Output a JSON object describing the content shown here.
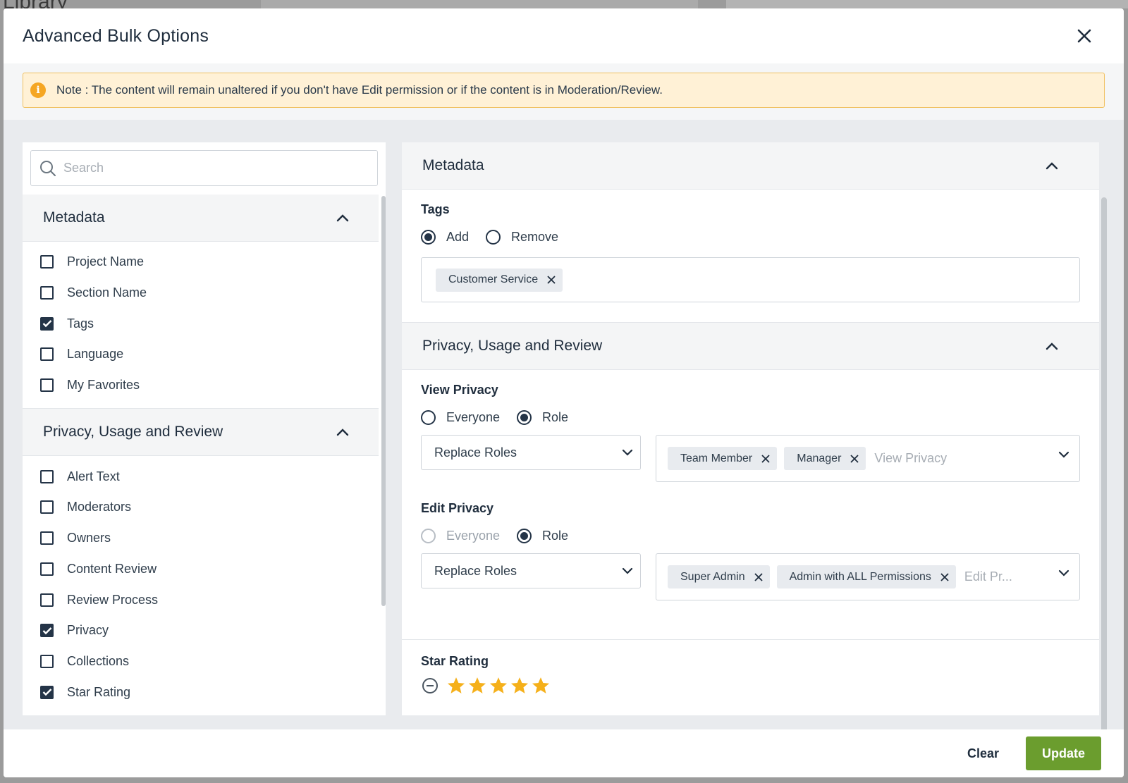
{
  "background": {
    "title": "Library"
  },
  "modal": {
    "title": "Advanced Bulk Options",
    "note": "Note : The content will remain unaltered if you don't have Edit permission or if the content is in Moderation/Review."
  },
  "left": {
    "search_placeholder": "Search",
    "sections": [
      {
        "title": "Metadata",
        "items": [
          {
            "label": "Project Name",
            "checked": false
          },
          {
            "label": "Section Name",
            "checked": false
          },
          {
            "label": "Tags",
            "checked": true
          },
          {
            "label": "Language",
            "checked": false
          },
          {
            "label": "My Favorites",
            "checked": false
          }
        ]
      },
      {
        "title": "Privacy, Usage and Review",
        "items": [
          {
            "label": "Alert Text",
            "checked": false
          },
          {
            "label": "Moderators",
            "checked": false
          },
          {
            "label": "Owners",
            "checked": false
          },
          {
            "label": "Content Review",
            "checked": false
          },
          {
            "label": "Review Process",
            "checked": false
          },
          {
            "label": "Privacy",
            "checked": true
          },
          {
            "label": "Collections",
            "checked": false
          },
          {
            "label": "Star Rating",
            "checked": true
          }
        ]
      }
    ]
  },
  "right": {
    "metadata": {
      "title": "Metadata",
      "tags_label": "Tags",
      "add_label": "Add",
      "remove_label": "Remove",
      "tags": [
        "Customer Service"
      ]
    },
    "privacy": {
      "title": "Privacy, Usage and Review",
      "view_privacy": {
        "label": "View Privacy",
        "everyone": "Everyone",
        "role": "Role",
        "mode": "Replace Roles",
        "roles": [
          "Team Member",
          "Manager"
        ],
        "placeholder": "View Privacy"
      },
      "edit_privacy": {
        "label": "Edit Privacy",
        "everyone": "Everyone",
        "role": "Role",
        "mode": "Replace Roles",
        "roles": [
          "Super Admin",
          "Admin with ALL Permissions"
        ],
        "placeholder": "Edit Pr..."
      },
      "star_rating": {
        "label": "Star Rating",
        "value": 5,
        "max": 5
      }
    }
  },
  "footer": {
    "clear": "Clear",
    "update": "Update"
  },
  "colors": {
    "accent": "#6b9d2e",
    "warning_bg": "#fff1d6",
    "star": "#f5b01a",
    "checkbox": "#243447"
  }
}
